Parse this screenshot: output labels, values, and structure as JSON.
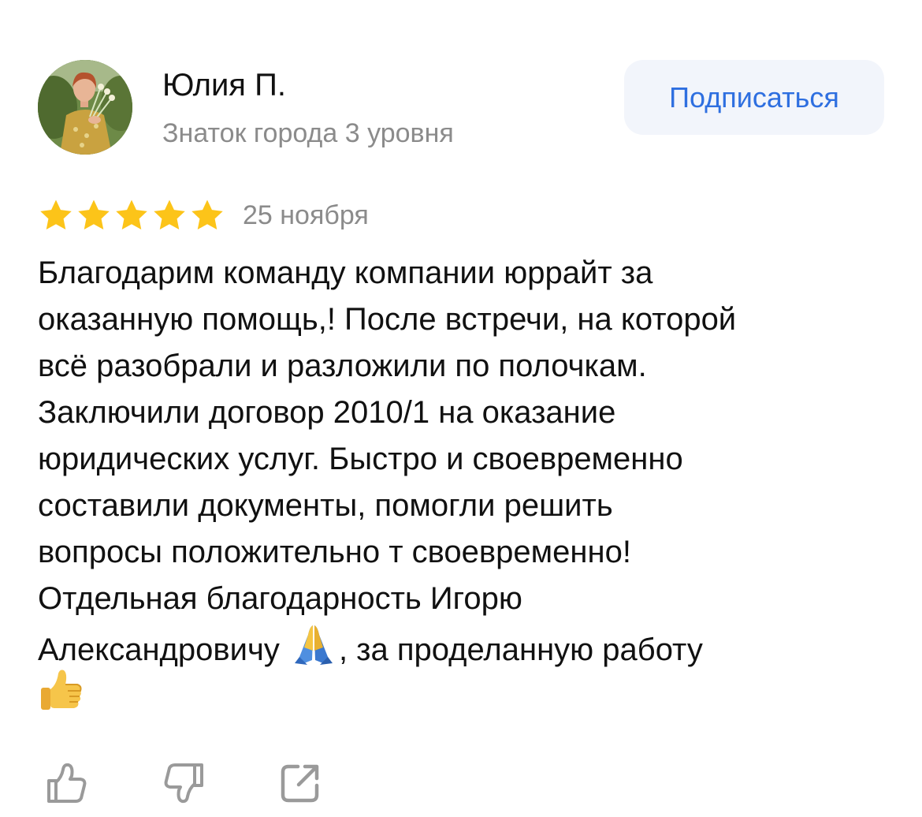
{
  "author": {
    "name": "Юлия П.",
    "level": "Знаток города 3 уровня",
    "avatar_icon": "user-photo"
  },
  "subscribe": {
    "label": "Подписаться"
  },
  "review": {
    "rating": 5,
    "rating_max": 5,
    "date": "25 ноября",
    "lines": [
      "Благодарим команду компании юррайт за",
      "оказанную помощь,! После встречи, на которой",
      "всё разобрали и разложили по полочкам.",
      "Заключили договор 2010/1 на оказание",
      "юридических услуг. Быстро и своевременно",
      "составили документы, помогли решить",
      "вопросы положительно т своевременно!",
      "Отдельная благодарность Игорю",
      "Александровичу",
      ", за проделанную работу"
    ],
    "emojis": [
      "folded-hands-emoji",
      "thumbs-up-emoji"
    ]
  },
  "actions": [
    {
      "name": "like-button",
      "icon": "thumbs-up-icon"
    },
    {
      "name": "dislike-button",
      "icon": "thumbs-down-icon"
    },
    {
      "name": "share-button",
      "icon": "share-icon"
    }
  ],
  "colors": {
    "accent": "#2e6fe0",
    "button_bg": "#f2f5fb",
    "star": "#fcc419",
    "secondary_text": "#8b8b8b",
    "icon": "#9a9a9a"
  }
}
